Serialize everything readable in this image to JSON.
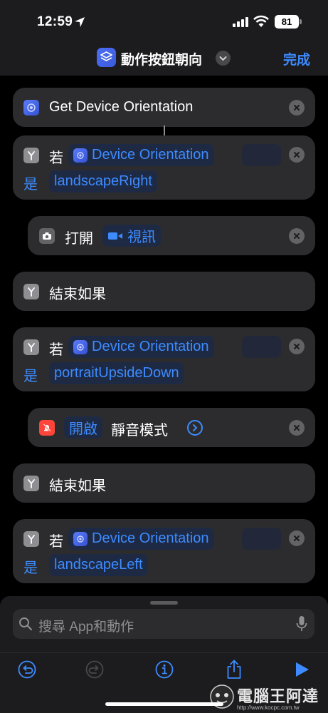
{
  "status": {
    "time": "12:59",
    "battery": "81"
  },
  "nav": {
    "title": "動作按鈕朝向",
    "done": "完成"
  },
  "actions": {
    "get_orientation": {
      "label": "Get Device Orientation"
    },
    "if1": {
      "keyword": "若",
      "var": "Device Orientation",
      "is": "是",
      "value": "landscapeRight"
    },
    "open_video": {
      "verb": "打開",
      "app": "視訊"
    },
    "end_if1": {
      "label": "結束如果"
    },
    "if2": {
      "keyword": "若",
      "var": "Device Orientation",
      "is": "是",
      "value": "portraitUpsideDown"
    },
    "silent": {
      "state": "開啟",
      "label": "靜音模式"
    },
    "end_if2": {
      "label": "結束如果"
    },
    "if3": {
      "keyword": "若",
      "var": "Device Orientation",
      "is": "是",
      "value": "landscapeLeft"
    }
  },
  "search": {
    "placeholder": "搜尋 App和動作"
  },
  "toolbar": {
    "icons": [
      "undo-icon",
      "redo-icon",
      "info-icon",
      "share-icon",
      "play-icon"
    ]
  },
  "watermark": {
    "text": "電腦王阿達",
    "url": "http://www.kocpc.com.tw"
  },
  "colors": {
    "accent": "#3d8bff",
    "card": "#2c2c2e",
    "background": "#000000",
    "panel": "#1c1c1e"
  }
}
